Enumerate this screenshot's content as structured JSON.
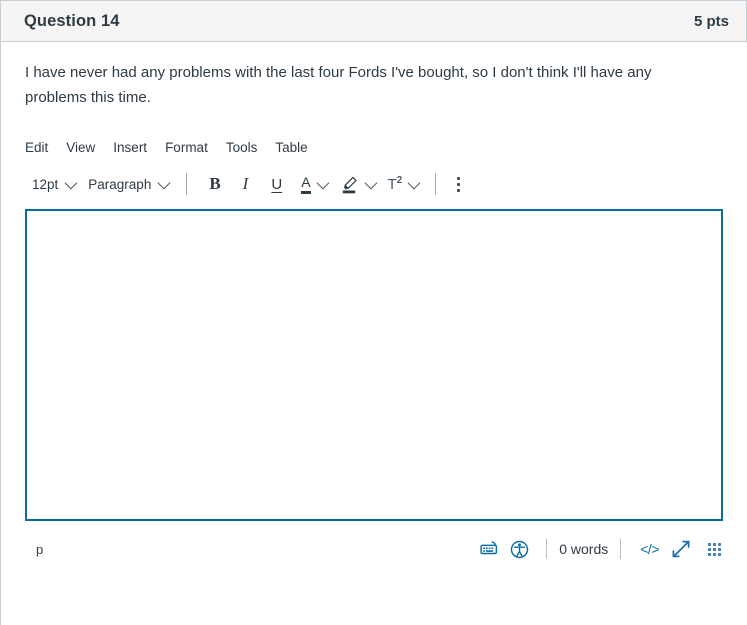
{
  "question": {
    "title": "Question 14",
    "points": "5 pts",
    "text": "I have never had any problems with the last four Fords I've bought, so I don't think I'll have any problems this time."
  },
  "editor": {
    "menubar": [
      {
        "label": "Edit",
        "name": "menu-edit"
      },
      {
        "label": "View",
        "name": "menu-view"
      },
      {
        "label": "Insert",
        "name": "menu-insert"
      },
      {
        "label": "Format",
        "name": "menu-format"
      },
      {
        "label": "Tools",
        "name": "menu-tools"
      },
      {
        "label": "Table",
        "name": "menu-table"
      }
    ],
    "toolbar": {
      "font_size": "12pt",
      "block_format": "Paragraph",
      "bold_label": "B",
      "italic_label": "I",
      "underline_label": "U",
      "text_color_label": "A",
      "highlight_icon": "highlighter-pen-icon",
      "superscript_label": "T",
      "superscript_exponent": "2",
      "more_icon": "kebab-menu-icon"
    },
    "content": "",
    "statusbar": {
      "element_path": "p",
      "math_keyboard_icon": "math-keyboard-icon",
      "accessibility_icon": "accessibility-checker-icon",
      "word_count": "0 words",
      "html_editor_label": "</>",
      "fullscreen_icon": "fullscreen-expand-icon",
      "resize_icon": "resize-grip-icon"
    }
  },
  "colors": {
    "accent": "#0a6b9e",
    "text": "#2d3b45",
    "header_bg": "#f5f5f5",
    "border": "#c7cdd1"
  }
}
